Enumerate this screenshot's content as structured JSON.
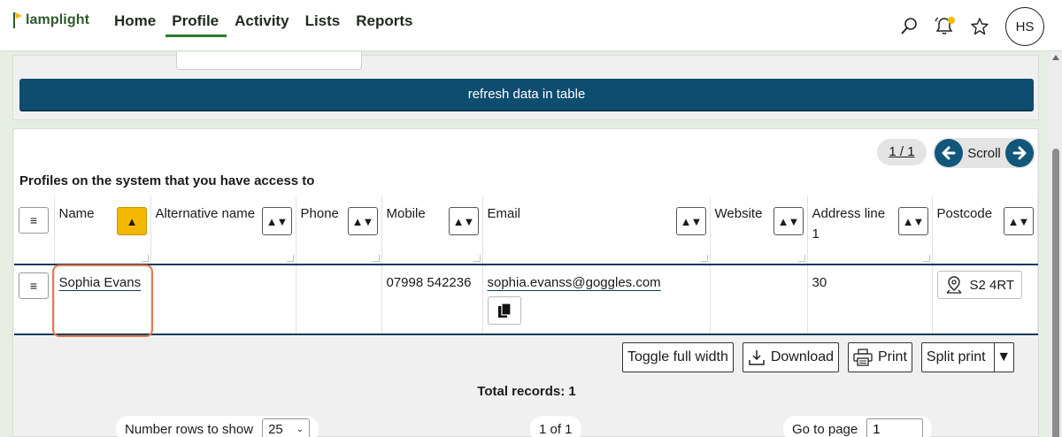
{
  "app": {
    "logo_text": "lamplight"
  },
  "nav": {
    "items": [
      {
        "label": "Home",
        "active": false
      },
      {
        "label": "Profile",
        "active": true
      },
      {
        "label": "Activity",
        "active": false
      },
      {
        "label": "Lists",
        "active": false
      },
      {
        "label": "Reports",
        "active": false
      }
    ],
    "user_initials": "HS",
    "notification_dot_color": "#f5b800"
  },
  "upper": {
    "refresh_label": "refresh data in table"
  },
  "table_panel": {
    "page_indicator": "1 / 1",
    "scroll_label": "Scroll",
    "caption": "Profiles on the system that you have access to",
    "menu_glyph": "≡",
    "columns": [
      {
        "label": "Name"
      },
      {
        "label": "Alternative name"
      },
      {
        "label": "Phone"
      },
      {
        "label": "Mobile"
      },
      {
        "label": "Email"
      },
      {
        "label": "Website"
      },
      {
        "label": "Address line 1"
      },
      {
        "label": "Postcode"
      }
    ],
    "rows": [
      {
        "name": "Sophia Evans",
        "alternative_name": "",
        "phone": "",
        "mobile": "07998 542236",
        "email": "sophia.evanss@goggles.com",
        "website": "",
        "address_line_1": "30",
        "postcode": "S2 4RT"
      }
    ],
    "actions": {
      "toggle_label": "Toggle full width",
      "download_label": "Download",
      "print_label": "Print",
      "split_print_label": "Split print"
    },
    "total_label": "Total records: 1",
    "rows_to_show_label": "Number rows to show",
    "rows_to_show_value": "25",
    "page_of": "1 of 1",
    "goto_label": "Go to page",
    "goto_value": "1"
  },
  "colors": {
    "accent": "#0e4d70",
    "sort_active": "#f5b800",
    "highlight": "#e8784f",
    "nav_active": "#2b7a2b"
  }
}
